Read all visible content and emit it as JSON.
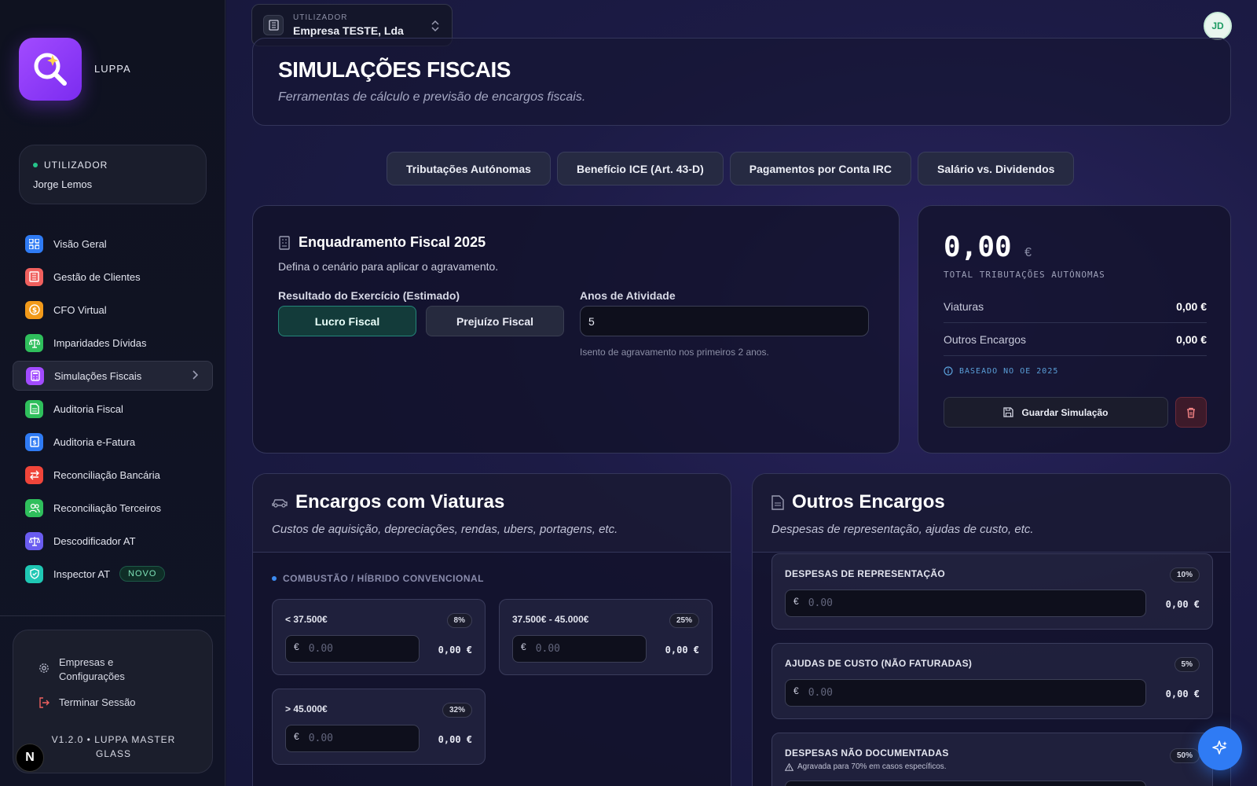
{
  "brand": {
    "name": "LUPPA"
  },
  "user_card": {
    "role": "UTILIZADOR",
    "name": "Jorge Lemos"
  },
  "nav": {
    "items": [
      {
        "label": "Visão Geral",
        "icon": "grid-icon",
        "color": "#2f7bf4"
      },
      {
        "label": "Gestão de Clientes",
        "icon": "building-icon",
        "color": "#f0605e"
      },
      {
        "label": "CFO Virtual",
        "icon": "dollar-circle-icon",
        "color": "#f29a1a"
      },
      {
        "label": "Imparidades Dívidas",
        "icon": "scale-icon",
        "color": "#2fbf5c"
      },
      {
        "label": "Simulações Fiscais",
        "icon": "calculator-icon",
        "color": "#a24bff"
      },
      {
        "label": "Auditoria Fiscal",
        "icon": "document-icon",
        "color": "#2fbf5c"
      },
      {
        "label": "Auditoria e-Fatura",
        "icon": "receipt-icon",
        "color": "#2f7bf4"
      },
      {
        "label": "Reconciliação Bancária",
        "icon": "arrows-icon",
        "color": "#f0453a"
      },
      {
        "label": "Reconciliação Terceiros",
        "icon": "users-icon",
        "color": "#2fbf5c"
      },
      {
        "label": "Descodificador AT",
        "icon": "scale-icon",
        "color": "#6a5cf0"
      },
      {
        "label": "Inspector AT",
        "icon": "shield-icon",
        "color": "#1fc7b4",
        "badge": "NOVO"
      }
    ]
  },
  "bottom": {
    "settings_line1": "Empresas e",
    "settings_line2": "Configurações",
    "logout": "Terminar Sessão",
    "version_line1": "V1.2.0 • LUPPA MASTER",
    "version_line2": "GLASS"
  },
  "n_badge": "N",
  "company": {
    "label": "UTILIZADOR",
    "value": "Empresa TESTE, Lda"
  },
  "avatar": "JD",
  "header": {
    "title": "SIMULAÇÕES FISCAIS",
    "subtitle": "Ferramentas de cálculo e previsão de encargos fiscais."
  },
  "tabs": [
    "Tributações Autónomas",
    "Benefício ICE (Art. 43-D)",
    "Pagamentos por Conta IRC",
    "Salário vs. Dividendos"
  ],
  "enquadramento": {
    "title": "Enquadramento Fiscal 2025",
    "subtitle": "Defina o cenário para aplicar o agravamento.",
    "result_label": "Resultado do Exercício (Estimado)",
    "option_profit": "Lucro Fiscal",
    "option_loss": "Prejuízo Fiscal",
    "years_label": "Anos de Atividade",
    "years_value": "5",
    "years_hint": "Isento de agravamento nos primeiros 2 anos."
  },
  "totals": {
    "value": "0,00",
    "currency": "€",
    "label": "TOTAL TRIBUTAÇÕES AUTÓNOMAS",
    "rows": [
      {
        "label": "Viaturas",
        "value": "0,00 €"
      },
      {
        "label": "Outros Encargos",
        "value": "0,00 €"
      }
    ],
    "based_on": "BASEADO NO OE 2025",
    "save_label": "Guardar Simulação"
  },
  "viaturas": {
    "title": "Encargos com Viaturas",
    "subtitle": "Custos de aquisição, depreciações, rendas, ubers, portagens, etc.",
    "category": "COMBUSTÃO / HÍBRIDO CONVENCIONAL",
    "tiers": [
      {
        "name": "< 37.500€",
        "rate": "8%",
        "currency": "€",
        "placeholder": "0.00",
        "amount": "0,00 €"
      },
      {
        "name": "37.500€ - 45.000€",
        "rate": "25%",
        "currency": "€",
        "placeholder": "0.00",
        "amount": "0,00 €"
      },
      {
        "name": "> 45.000€",
        "rate": "32%",
        "currency": "€",
        "placeholder": "0.00",
        "amount": "0,00 €"
      }
    ]
  },
  "outros": {
    "title": "Outros Encargos",
    "subtitle": "Despesas de representação, ajudas de custo, etc.",
    "items": [
      {
        "name": "DESPESAS DE REPRESENTAÇÃO",
        "rate": "10%",
        "currency": "€",
        "placeholder": "0.00",
        "amount": "0,00 €"
      },
      {
        "name": "AJUDAS DE CUSTO (NÃO FATURADAS)",
        "rate": "5%",
        "currency": "€",
        "placeholder": "0.00",
        "amount": "0,00 €"
      },
      {
        "name": "DESPESAS NÃO DOCUMENTADAS",
        "rate": "50%",
        "note": "Agravada para 70% em casos específicos."
      }
    ]
  },
  "colors": {
    "accent_purple": "#a24bff",
    "accent_teal": "#24867a",
    "fab_blue": "#2f7bf4"
  }
}
